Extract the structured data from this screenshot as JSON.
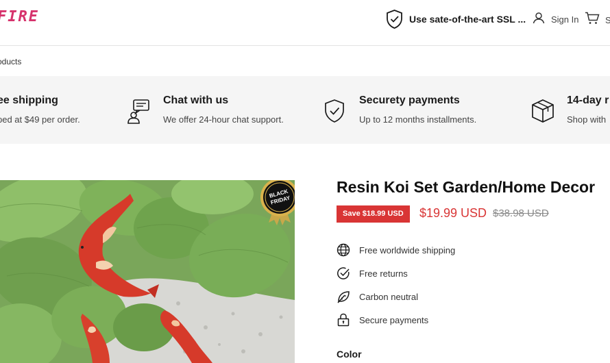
{
  "header": {
    "logo_text": "FIRE",
    "ssl_text": "Use sate-of-the-art SSL ...",
    "signin_label": "Sign In",
    "cart_label": "S"
  },
  "breadcrumb": {
    "text": "oducts"
  },
  "features": [
    {
      "icon": "shipping-icon",
      "title": "ee shipping",
      "desc": "ped at $49 per order."
    },
    {
      "icon": "chat-support-icon",
      "title": "Chat with us",
      "desc": "We offer 24-hour chat support."
    },
    {
      "icon": "shield-check-icon",
      "title": "Securety payments",
      "desc": "Up to 12 months installments."
    },
    {
      "icon": "box-icon",
      "title": "14-day r",
      "desc": "Shop with"
    }
  ],
  "product": {
    "title": "Resin Koi Set Garden/Home Decor",
    "save_badge": "Save $18.99 USD",
    "price": "$19.99 USD",
    "compare_price": "$38.98 USD",
    "image_badge": [
      "BLACK",
      "FRIDAY"
    ],
    "benefits": [
      {
        "icon": "globe-icon",
        "label": "Free worldwide shipping"
      },
      {
        "icon": "check-circle-icon",
        "label": "Free returns"
      },
      {
        "icon": "leaf-icon",
        "label": "Carbon neutral"
      },
      {
        "icon": "lock-icon",
        "label": "Secure payments"
      }
    ],
    "color_label": "Color"
  },
  "colors": {
    "accent_red": "#d93535",
    "logo_pink": "#d6336c",
    "band_gray": "#f5f5f5"
  }
}
